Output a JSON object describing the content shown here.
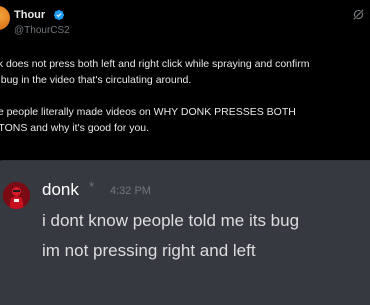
{
  "tweet": {
    "author_name": "Thour",
    "author_handle": "@ThourCS2",
    "lines": [
      "nk does not press both left and right click while spraying and confirm",
      "a bug in the video that's circulating around.",
      "he people literally made videos on WHY DONK PRESSES BOTH",
      "TTONS and why it's good for you."
    ]
  },
  "embed": {
    "username": "donk",
    "star": "*",
    "timestamp": "4:32 PM",
    "messages": [
      "i dont know people told me its bug",
      "im not pressing right and left"
    ]
  },
  "colors": {
    "background": "#000000",
    "text": "#e7e9ea",
    "muted": "#71767b",
    "verified": "#1d9bf0",
    "embed_bg": "#36393f",
    "embed_text": "#dcddde"
  },
  "icons": {
    "verified": "verified-badge-icon",
    "grok": "grok-icon"
  }
}
